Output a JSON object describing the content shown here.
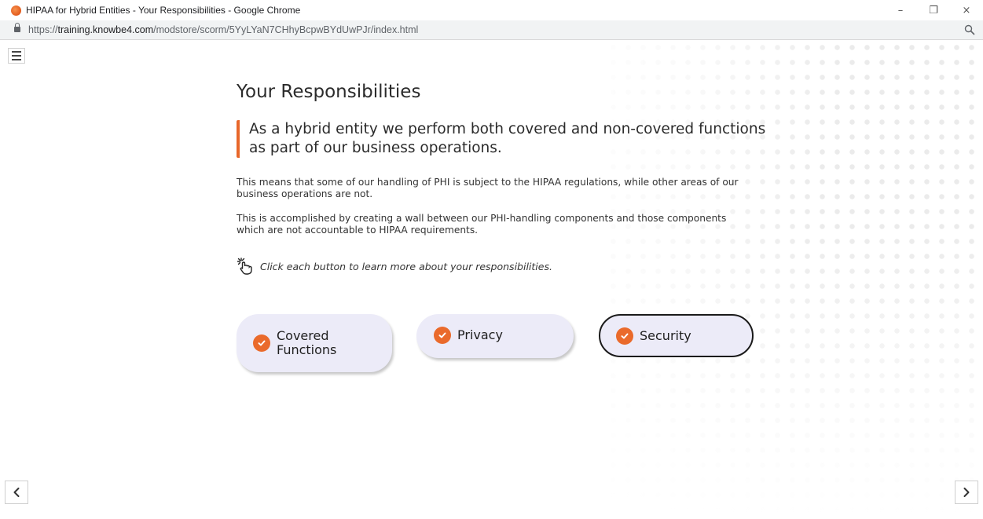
{
  "window": {
    "title": "HIPAA for Hybrid Entities - Your Responsibilities - Google Chrome",
    "controls": {
      "minimize": "–",
      "restore": "❐",
      "close": "×"
    }
  },
  "address_bar": {
    "url_prefix": "https://",
    "url_host": "training.knowbe4.com",
    "url_path": "/modstore/scorm/5YyLYaN7CHhyBcpwBYdUwPJr/index.html"
  },
  "page": {
    "title": "Your Responsibilities",
    "quote": "As a hybrid entity we perform both covered and non-covered functions as part of our business operations.",
    "paragraphs": [
      "This means that some of our handling of PHI is subject to the HIPAA regulations, while other areas of our business operations are not.",
      "This is accomplished by creating a wall between our PHI-handling components and those components which are not accountable to HIPAA requirements."
    ],
    "instruction": "Click each button to learn more about your responsibilities.",
    "buttons": [
      {
        "line1": "Covered",
        "line2": "Functions",
        "completed": true
      },
      {
        "label": "Privacy",
        "completed": true
      },
      {
        "label": "Security",
        "completed": true,
        "selected": true
      }
    ]
  },
  "icons": {
    "menu": "hamburger-menu-icon",
    "hand": "tap-hand-icon",
    "check": "check-circle-icon",
    "prev": "chevron-left-icon",
    "next": "chevron-right-icon",
    "lock": "lock-icon",
    "zoom": "zoom-icon"
  },
  "colors": {
    "accent": "#e8672a",
    "button_bg": "#ecebf8",
    "selected_border": "#1a1a1a"
  }
}
